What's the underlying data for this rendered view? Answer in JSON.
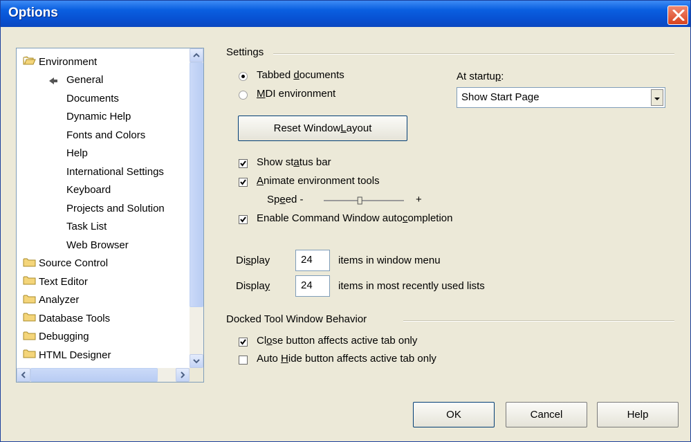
{
  "window": {
    "title": "Options",
    "close_icon": "close-icon"
  },
  "tree": {
    "items": [
      {
        "label": "Environment",
        "level": 0,
        "icon": "folder-open-icon"
      },
      {
        "label": "General",
        "level": 1,
        "selected_marker": "arrow-icon"
      },
      {
        "label": "Documents",
        "level": 1
      },
      {
        "label": "Dynamic Help",
        "level": 1
      },
      {
        "label": "Fonts and Colors",
        "level": 1
      },
      {
        "label": "Help",
        "level": 1
      },
      {
        "label": "International Settings",
        "level": 1
      },
      {
        "label": "Keyboard",
        "level": 1
      },
      {
        "label": "Projects and Solution",
        "level": 1
      },
      {
        "label": "Task List",
        "level": 1
      },
      {
        "label": "Web Browser",
        "level": 1
      },
      {
        "label": "Source Control",
        "level": 0,
        "icon": "folder-icon"
      },
      {
        "label": "Text Editor",
        "level": 0,
        "icon": "folder-icon"
      },
      {
        "label": "Analyzer",
        "level": 0,
        "icon": "folder-icon"
      },
      {
        "label": "Database Tools",
        "level": 0,
        "icon": "folder-icon"
      },
      {
        "label": "Debugging",
        "level": 0,
        "icon": "folder-icon"
      },
      {
        "label": "HTML Designer",
        "level": 0,
        "icon": "folder-icon"
      }
    ]
  },
  "settings": {
    "heading": "Settings",
    "radio_tabbed": {
      "pre": "Tabbed ",
      "u": "d",
      "post": "ocuments",
      "selected": true
    },
    "radio_mdi": {
      "pre": "",
      "u": "M",
      "post": "DI environment",
      "selected": false
    },
    "startup_label": {
      "pre": "At startu",
      "u": "p",
      "post": ":"
    },
    "startup_value": "Show Start Page",
    "reset_button": {
      "pre": "Reset Window ",
      "u": "L",
      "post": "ayout"
    },
    "show_status": {
      "pre": "Show st",
      "u": "a",
      "post": "tus bar",
      "checked": true
    },
    "animate_tools": {
      "pre": "",
      "u": "A",
      "post": "nimate environment tools",
      "checked": true
    },
    "speed": {
      "pre": "Sp",
      "u": "e",
      "post": "ed -",
      "plus": "+",
      "level_fraction": 0.45
    },
    "autocompletion": {
      "pre": "Enable Command Window auto",
      "u": "c",
      "post": "ompletion",
      "checked": true
    },
    "display1": {
      "label_pre": "Di",
      "label_u": "s",
      "label_post": "play",
      "value": "24",
      "suffix": "items in window menu"
    },
    "display2": {
      "label_pre": "Displa",
      "label_u": "y",
      "label_post": "",
      "value": "24",
      "suffix": "items in most recently used lists"
    }
  },
  "docked": {
    "heading": "Docked Tool Window Behavior",
    "close_affects": {
      "pre": "Cl",
      "u": "o",
      "post": "se button affects active tab only",
      "checked": true
    },
    "autohide_affects": {
      "pre": "Auto ",
      "u": "H",
      "post": "ide button affects active tab only",
      "checked": false
    }
  },
  "buttons": {
    "ok": "OK",
    "cancel": "Cancel",
    "help": "Help"
  },
  "colors": {
    "titlebar": "#0a5fe0",
    "dialog_bg": "#ece9d8",
    "close_btn": "#d8431e"
  }
}
